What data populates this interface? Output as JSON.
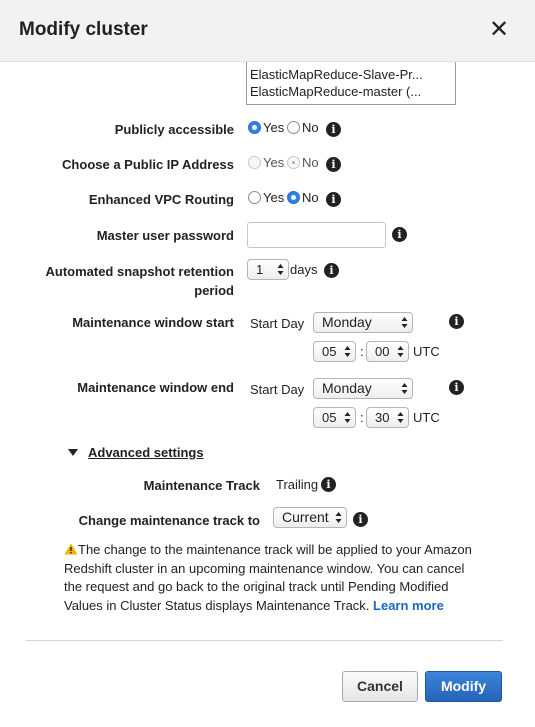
{
  "dialog": {
    "title": "Modify cluster",
    "close_glyph": "✕"
  },
  "security_groups": {
    "items": [
      "ElasticMapReduce-Slave-Pr...",
      "ElasticMapReduce-master (..."
    ]
  },
  "fields": {
    "publicly_accessible": {
      "label": "Publicly accessible",
      "yes": "Yes",
      "no": "No",
      "selected": "Yes"
    },
    "public_ip": {
      "label": "Choose a Public IP Address",
      "yes": "Yes",
      "no": "No",
      "selected": "No",
      "disabled": true
    },
    "enhanced_vpc": {
      "label": "Enhanced VPC Routing",
      "yes": "Yes",
      "no": "No",
      "selected": "No"
    },
    "master_password": {
      "label": "Master user password",
      "value": ""
    },
    "snapshot_retention": {
      "label_line1": "Automated snapshot retention",
      "label_line2": "period",
      "value": "1",
      "unit": "days"
    },
    "maintenance_start": {
      "label": "Maintenance window start",
      "day_label": "Start Day",
      "day": "Monday",
      "hour": "05",
      "minute": "00",
      "tz": "UTC"
    },
    "maintenance_end": {
      "label": "Maintenance window end",
      "day_label": "Start Day",
      "day": "Monday",
      "hour": "05",
      "minute": "30",
      "tz": "UTC"
    }
  },
  "advanced": {
    "toggle_label": "Advanced settings",
    "track_label": "Maintenance Track",
    "track_value": "Trailing",
    "change_label": "Change maintenance track to",
    "change_value": "Current"
  },
  "note": {
    "text": "The change to the maintenance track will be applied to your Amazon Redshift cluster in an upcoming maintenance window. You can cancel the request and go back to the original track until Pending Modified Values in Cluster Status displays Maintenance Track.",
    "link": "Learn more"
  },
  "buttons": {
    "cancel": "Cancel",
    "modify": "Modify"
  },
  "colors": {
    "primary": "#2e6fc4",
    "link": "#1a66c4",
    "warning": "#f0b400"
  },
  "separators": {
    "time": ":"
  },
  "icons": {
    "info": "i"
  }
}
